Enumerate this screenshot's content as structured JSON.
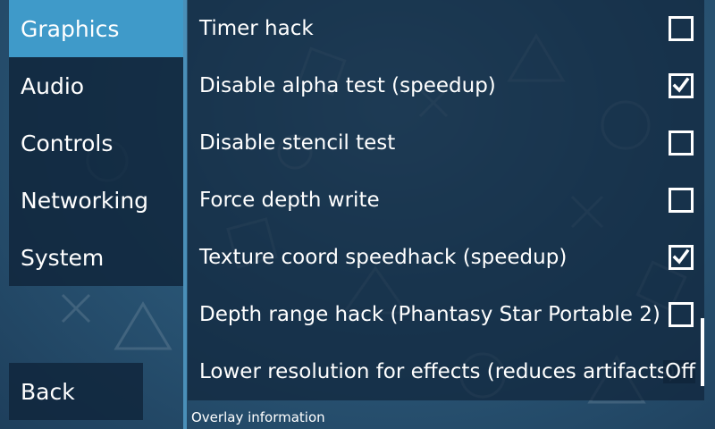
{
  "sidebar": {
    "tabs": [
      {
        "label": "Graphics",
        "active": true
      },
      {
        "label": "Audio",
        "active": false
      },
      {
        "label": "Controls",
        "active": false
      },
      {
        "label": "Networking",
        "active": false
      },
      {
        "label": "System",
        "active": false
      }
    ],
    "back_label": "Back"
  },
  "settings": [
    {
      "label": "Timer hack",
      "checked": false
    },
    {
      "label": "Disable alpha test (speedup)",
      "checked": true
    },
    {
      "label": "Disable stencil test",
      "checked": false
    },
    {
      "label": "Force depth write",
      "checked": false
    },
    {
      "label": "Texture coord speedhack (speedup)",
      "checked": true
    },
    {
      "label": "Depth range hack (Phantasy Star Portable 2)",
      "checked": false
    },
    {
      "label": "Lower resolution for effects (reduces artifacts)",
      "value": "Off"
    }
  ],
  "next_section": "Overlay information",
  "colors": {
    "accent": "#3f9ac9",
    "panel": "#10263c",
    "background": "#2b5878"
  }
}
